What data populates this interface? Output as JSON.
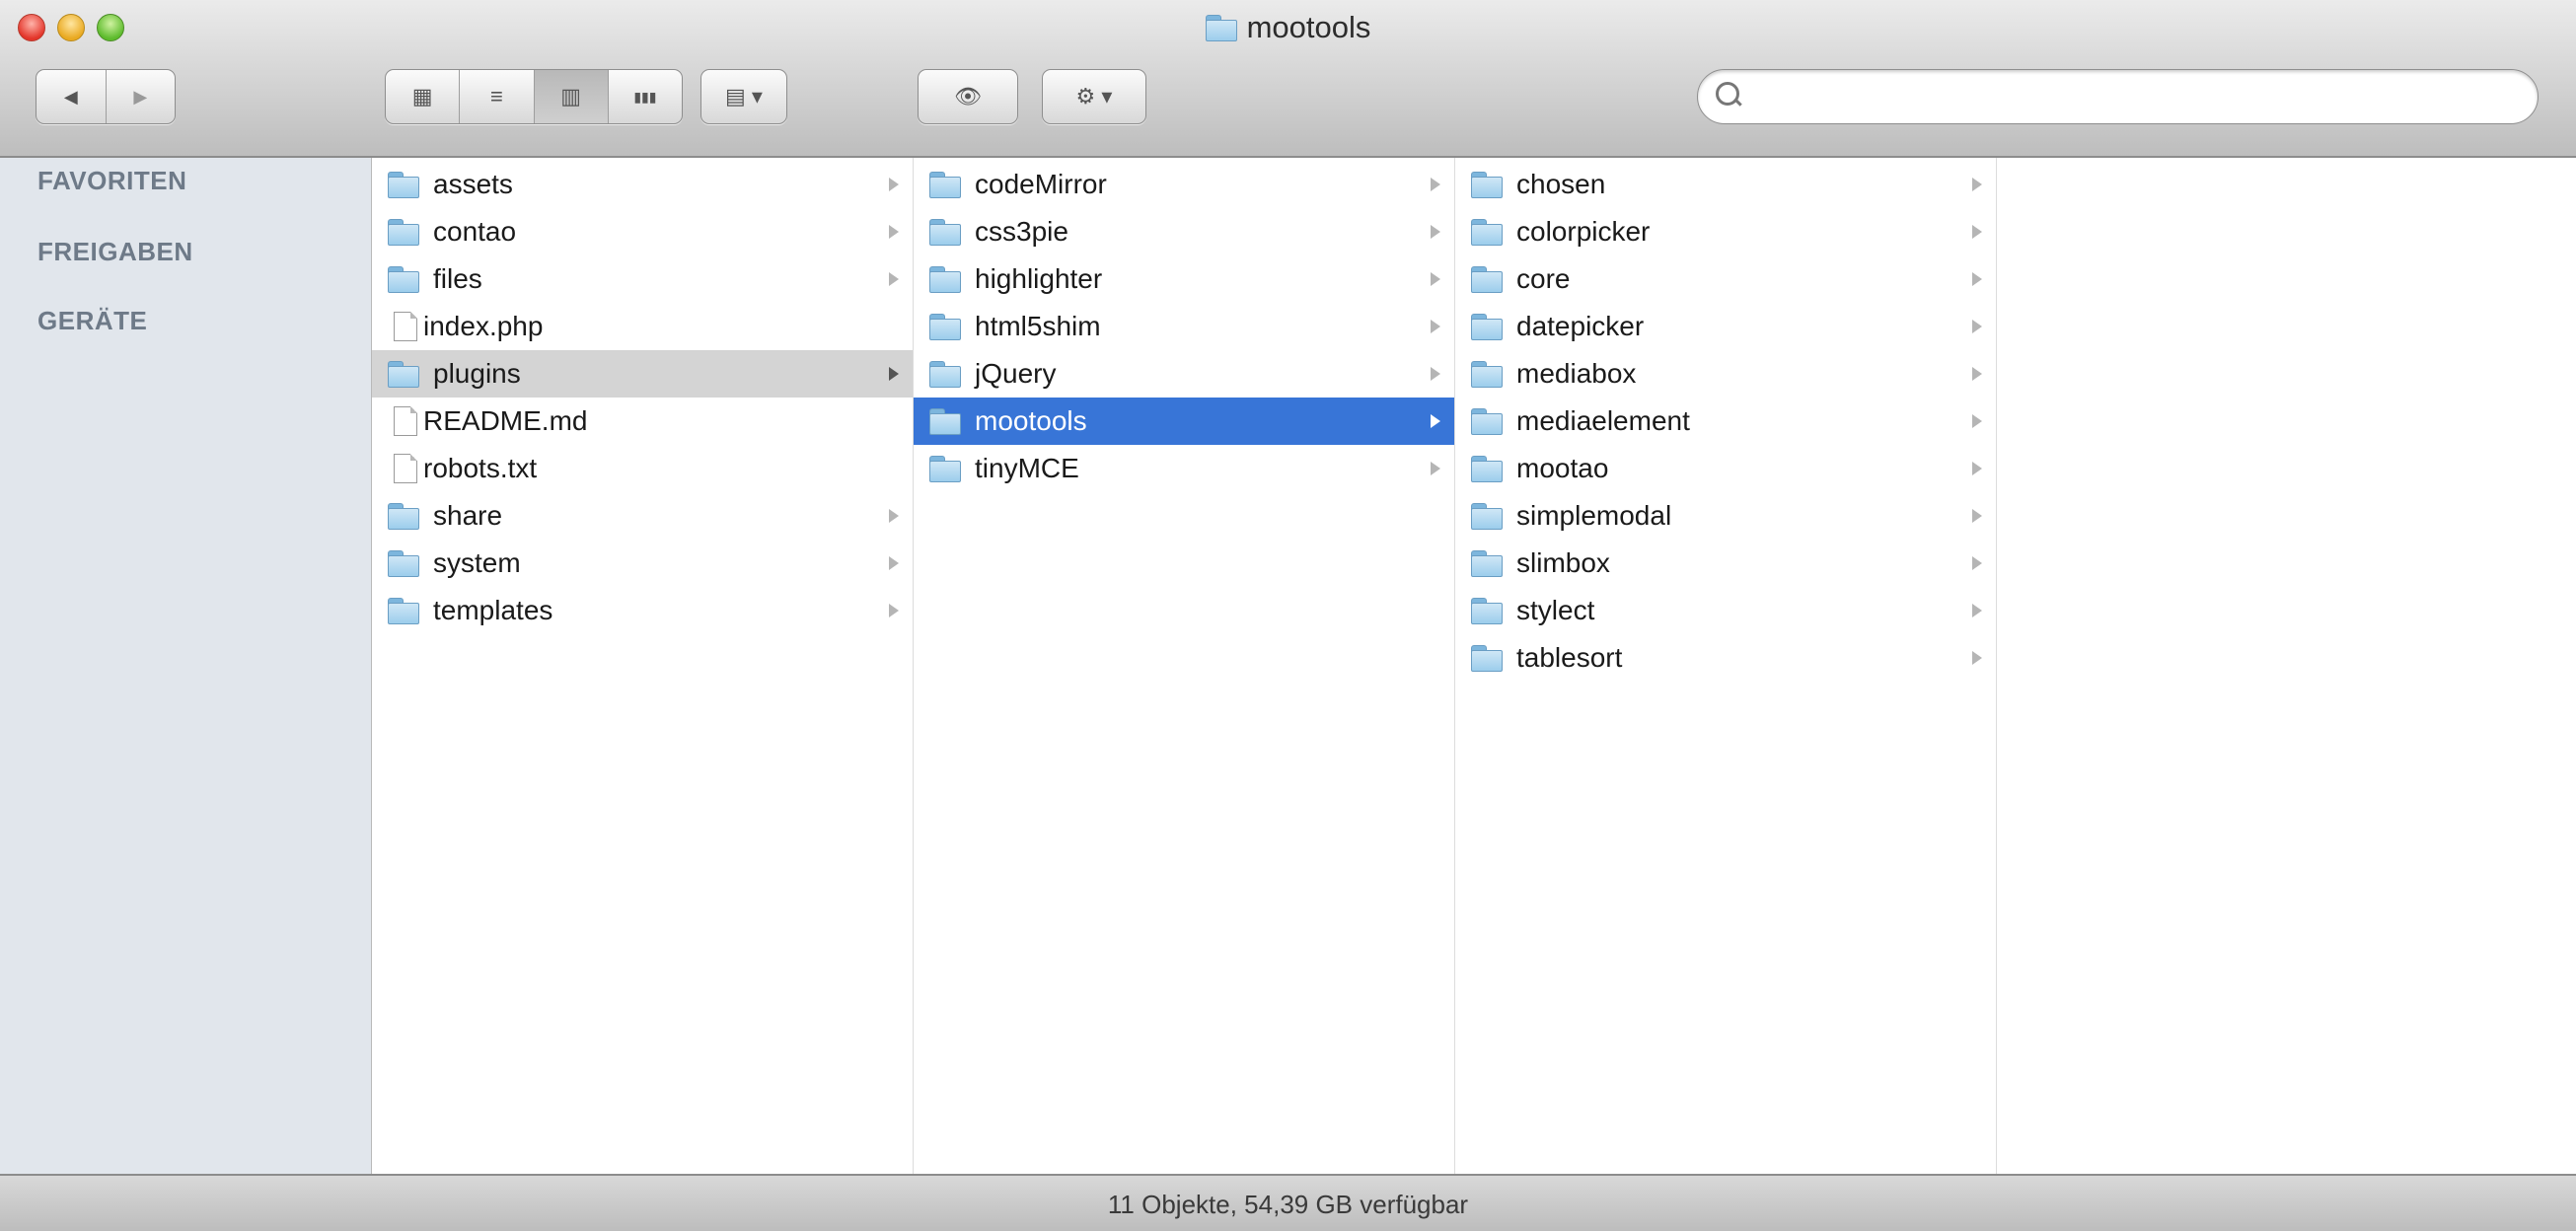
{
  "window": {
    "title": "mootools"
  },
  "toolbar": {
    "back_label": "◀",
    "forward_label": "▶",
    "view_icons_label": "▦",
    "view_list_label": "≡",
    "view_columns_label": "▥",
    "view_coverflow_label": "▮▮▮",
    "arrange_label": "▤ ▾",
    "quicklook_label": "👁",
    "action_label": "⚙ ▾",
    "search_placeholder": "",
    "search_value": ""
  },
  "sidebar": {
    "sections": [
      "FAVORITEN",
      "FREIGABEN",
      "GERÄTE"
    ]
  },
  "columns": [
    {
      "items": [
        {
          "name": "assets",
          "type": "folder",
          "state": ""
        },
        {
          "name": "contao",
          "type": "folder",
          "state": ""
        },
        {
          "name": "files",
          "type": "folder",
          "state": ""
        },
        {
          "name": "index.php",
          "type": "file",
          "state": ""
        },
        {
          "name": "plugins",
          "type": "folder",
          "state": "parent"
        },
        {
          "name": "README.md",
          "type": "file",
          "state": ""
        },
        {
          "name": "robots.txt",
          "type": "file",
          "state": ""
        },
        {
          "name": "share",
          "type": "folder",
          "state": ""
        },
        {
          "name": "system",
          "type": "folder",
          "state": ""
        },
        {
          "name": "templates",
          "type": "folder",
          "state": ""
        }
      ]
    },
    {
      "items": [
        {
          "name": "codeMirror",
          "type": "folder",
          "state": ""
        },
        {
          "name": "css3pie",
          "type": "folder",
          "state": ""
        },
        {
          "name": "highlighter",
          "type": "folder",
          "state": ""
        },
        {
          "name": "html5shim",
          "type": "folder",
          "state": ""
        },
        {
          "name": "jQuery",
          "type": "folder",
          "state": ""
        },
        {
          "name": "mootools",
          "type": "folder",
          "state": "selected"
        },
        {
          "name": "tinyMCE",
          "type": "folder",
          "state": ""
        }
      ]
    },
    {
      "items": [
        {
          "name": "chosen",
          "type": "folder",
          "state": ""
        },
        {
          "name": "colorpicker",
          "type": "folder",
          "state": ""
        },
        {
          "name": "core",
          "type": "folder",
          "state": ""
        },
        {
          "name": "datepicker",
          "type": "folder",
          "state": ""
        },
        {
          "name": "mediabox",
          "type": "folder",
          "state": ""
        },
        {
          "name": "mediaelement",
          "type": "folder",
          "state": ""
        },
        {
          "name": "mootao",
          "type": "folder",
          "state": ""
        },
        {
          "name": "simplemodal",
          "type": "folder",
          "state": ""
        },
        {
          "name": "slimbox",
          "type": "folder",
          "state": ""
        },
        {
          "name": "stylect",
          "type": "folder",
          "state": ""
        },
        {
          "name": "tablesort",
          "type": "folder",
          "state": ""
        }
      ]
    },
    {
      "items": []
    }
  ],
  "status": {
    "text": "11 Objekte, 54,39 GB verfügbar"
  },
  "colors": {
    "selection": "#3875d7",
    "sidebar_bg": "#e1e6ec",
    "parent_highlight": "#d4d4d4"
  }
}
